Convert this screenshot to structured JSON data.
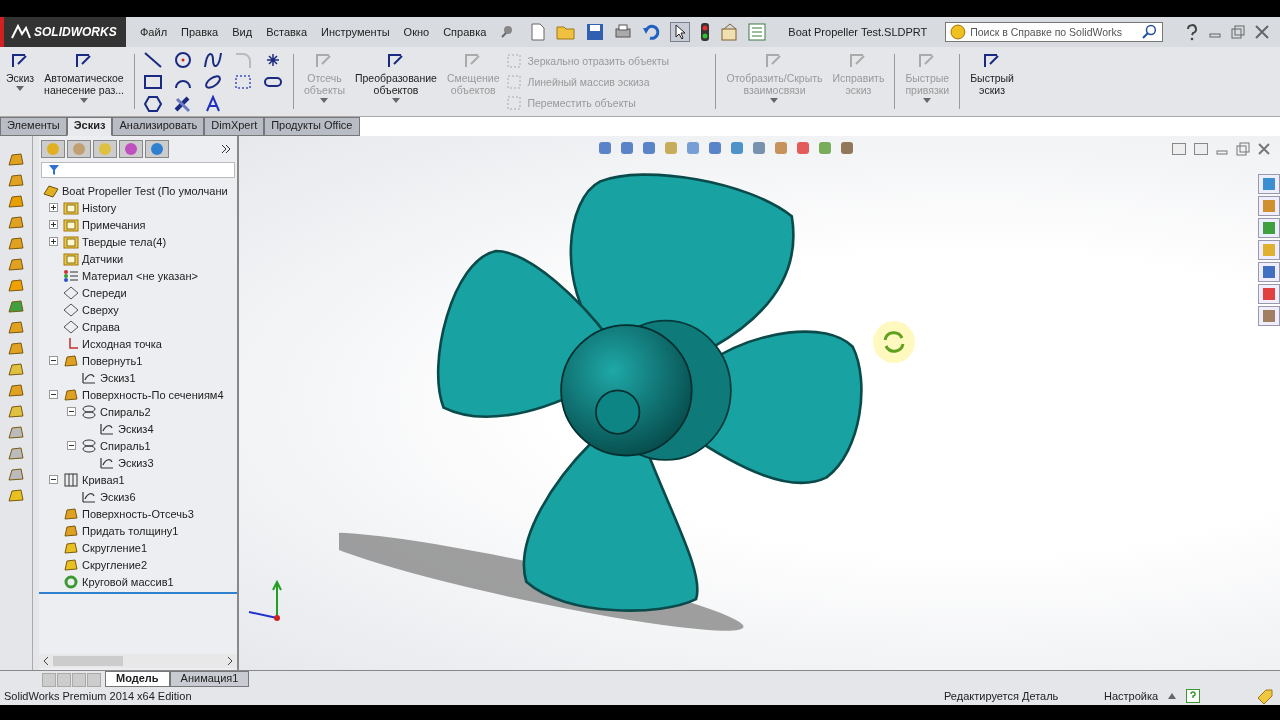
{
  "app": {
    "logo": "SOLIDWORKS",
    "file_name": "Boat Propeller Test.SLDPRT"
  },
  "menu": [
    "Файл",
    "Правка",
    "Вид",
    "Вставка",
    "Инструменты",
    "Окно",
    "Справка"
  ],
  "search": {
    "placeholder": "Поиск в Справке по SolidWorks"
  },
  "ribbon": [
    {
      "kind": "large",
      "label": "Эскиз",
      "disabled": false,
      "dropdown": true
    },
    {
      "kind": "large",
      "label": "Автоматическое\nнанесение раз...",
      "disabled": false,
      "dropdown": true
    },
    {
      "kind": "divider"
    },
    {
      "kind": "tools"
    },
    {
      "kind": "divider"
    },
    {
      "kind": "large",
      "label": "Отсечь\nобъекты",
      "disabled": true,
      "dropdown": true
    },
    {
      "kind": "large",
      "label": "Преобразование\nобъектов",
      "disabled": false,
      "dropdown": true
    },
    {
      "kind": "large",
      "label": "Смещение\nобъектов",
      "disabled": true,
      "dropdown": false
    },
    {
      "kind": "stack",
      "items": [
        {
          "label": "Зеркально отразить объекты",
          "disabled": true
        },
        {
          "label": "Линейный массив эскиза",
          "disabled": true
        },
        {
          "label": "Переместить объекты",
          "disabled": true
        }
      ]
    },
    {
      "kind": "divider"
    },
    {
      "kind": "large",
      "label": "Отобразить/Скрыть\nвзаимосвязи",
      "disabled": true,
      "dropdown": true
    },
    {
      "kind": "large",
      "label": "Исправить\nэскиз",
      "disabled": true,
      "dropdown": false
    },
    {
      "kind": "divider"
    },
    {
      "kind": "large",
      "label": "Быстрые\nпривязки",
      "disabled": true,
      "dropdown": true
    },
    {
      "kind": "divider"
    },
    {
      "kind": "large",
      "label": "Быстрый\nэскиз",
      "disabled": false,
      "dropdown": false
    }
  ],
  "tabs": [
    {
      "label": "Элементы",
      "selected": false
    },
    {
      "label": "Эскиз",
      "selected": true
    },
    {
      "label": "Анализировать",
      "selected": false
    },
    {
      "label": "DimXpert",
      "selected": false
    },
    {
      "label": "Продукты Office",
      "selected": false
    }
  ],
  "tree": {
    "title": "Boat Propeller Test  (По умолчани",
    "items": [
      {
        "label": "History",
        "kind": "folder",
        "expanded": false
      },
      {
        "label": "Примечания",
        "kind": "annotation",
        "expanded": false
      },
      {
        "label": "Твердые тела(4)",
        "kind": "folder",
        "expanded": false
      },
      {
        "label": "Датчики",
        "kind": "folder"
      },
      {
        "label": "Материал <не указан>",
        "kind": "material"
      },
      {
        "label": "Спереди",
        "kind": "plane"
      },
      {
        "label": "Сверху",
        "kind": "plane"
      },
      {
        "label": "Справа",
        "kind": "plane"
      },
      {
        "label": "Исходная точка",
        "kind": "origin"
      },
      {
        "label": "Повернуть1",
        "kind": "feature",
        "expanded": true,
        "children": [
          {
            "label": "Эскиз1",
            "kind": "sketch"
          }
        ]
      },
      {
        "label": "Поверхность-По сечениям4",
        "kind": "feature",
        "expanded": true,
        "children": [
          {
            "label": "Спираль2",
            "kind": "helix",
            "expanded": true,
            "children": [
              {
                "label": "Эскиз4",
                "kind": "sketch"
              }
            ]
          },
          {
            "label": "Спираль1",
            "kind": "helix",
            "expanded": true,
            "children": [
              {
                "label": "Эскиз3",
                "kind": "sketch"
              }
            ]
          }
        ]
      },
      {
        "label": "Кривая1",
        "kind": "curve",
        "expanded": true,
        "children": [
          {
            "label": "Эскиз6",
            "kind": "sketch"
          }
        ]
      },
      {
        "label": "Поверхность-Отсечь3",
        "kind": "feature"
      },
      {
        "label": "Придать толщину1",
        "kind": "feature"
      },
      {
        "label": "Скругление1",
        "kind": "fillet"
      },
      {
        "label": "Скругление2",
        "kind": "fillet"
      },
      {
        "label": "Круговой массив1",
        "kind": "pattern"
      }
    ]
  },
  "bottom_tabs": [
    {
      "label": "Модель",
      "selected": true
    },
    {
      "label": "Анимация1",
      "selected": false
    }
  ],
  "status_bar": {
    "edition": "SolidWorks Premium 2014 x64 Edition",
    "mode": "Редактируется Деталь",
    "units": "Настройка"
  }
}
